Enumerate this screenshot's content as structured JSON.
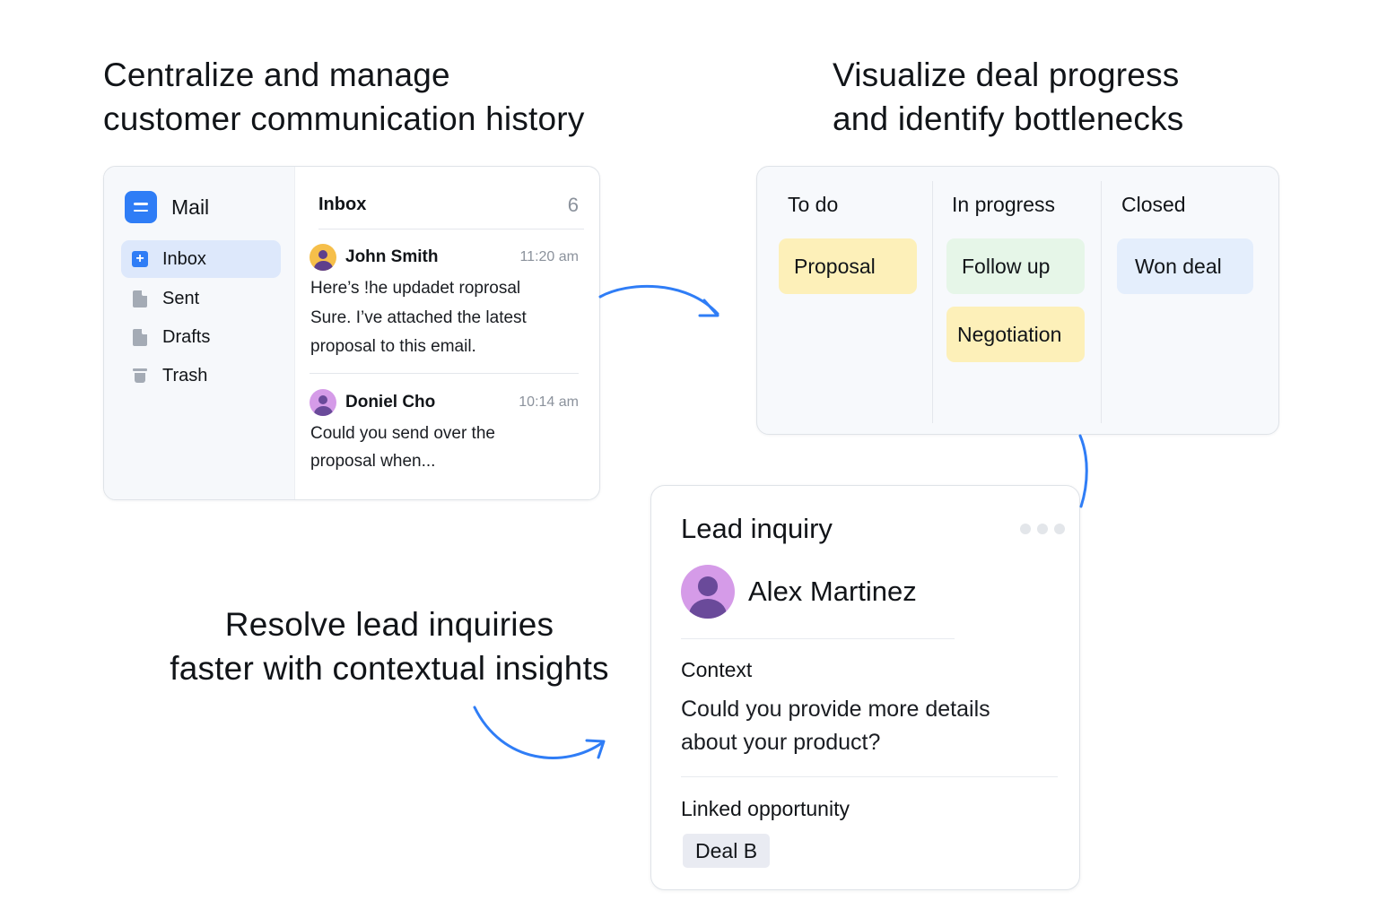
{
  "headlines": {
    "communication": [
      "Centralize and manage",
      "customer communication history"
    ],
    "deals": [
      "Visualize deal progress",
      "and identify bottlenecks"
    ],
    "leads": [
      "Resolve lead inquiries",
      "faster with contextual insights"
    ]
  },
  "mail": {
    "app_title": "Mail",
    "sidebar": [
      {
        "label": "Inbox",
        "icon": "plus-square-icon",
        "active": true
      },
      {
        "label": "Sent",
        "icon": "document-icon"
      },
      {
        "label": "Drafts",
        "icon": "document-icon"
      },
      {
        "label": "Trash",
        "icon": "trash-icon"
      }
    ],
    "inbox_title": "Inbox",
    "inbox_count": "6",
    "messages": [
      {
        "sender": "John Smith",
        "time": "11:20 am",
        "lines": [
          "Here’s !he updadet roprosal",
          "Sure. I’ve attached the latest",
          "proposal to this email."
        ]
      },
      {
        "sender": "Doniel Cho",
        "time": "10:14 am",
        "lines": [
          "Could you send over the",
          "proposal when..."
        ]
      }
    ]
  },
  "kanban": {
    "columns": [
      {
        "title": "To do",
        "cards": [
          "Proposal"
        ]
      },
      {
        "title": "In progress",
        "cards": [
          "Follow up",
          "Negotiation"
        ]
      },
      {
        "title": "Closed",
        "cards": [
          "Won deal"
        ]
      }
    ]
  },
  "lead": {
    "title": "Lead inquiry",
    "name": "Alex Martinez",
    "context_label": "Context",
    "context_lines": [
      "Could you provide more details",
      "about your product?"
    ],
    "opportunity_label": "Linked opportunity",
    "opportunity_value": "Deal B"
  },
  "colors": {
    "accent": "#2f7df6",
    "active_nav": "#dde8fb",
    "chip_yellow": "#fdf0b9",
    "chip_green": "#e6f6e8",
    "chip_blue": "#e4eefc",
    "tag_bg": "#e9ebf2"
  }
}
